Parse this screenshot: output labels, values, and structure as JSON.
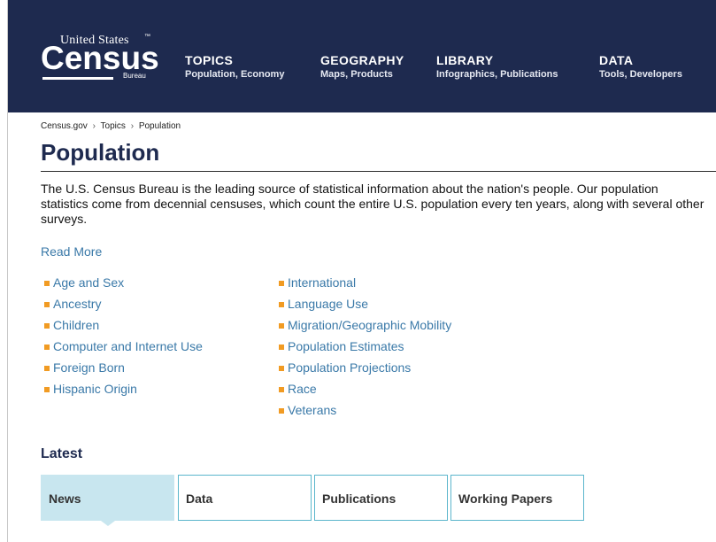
{
  "header": {
    "logo": {
      "top_text": "United States",
      "tm": "™",
      "word": "Census",
      "bottom_text": "Bureau"
    },
    "nav": [
      {
        "title": "TOPICS",
        "subtitle": "Population, Economy"
      },
      {
        "title": "GEOGRAPHY",
        "subtitle": "Maps, Products"
      },
      {
        "title": "LIBRARY",
        "subtitle": "Infographics, Publications"
      },
      {
        "title": "DATA",
        "subtitle": "Tools, Developers"
      }
    ]
  },
  "breadcrumb": {
    "items": [
      "Census.gov",
      "Topics",
      "Population"
    ],
    "separator": "›"
  },
  "page": {
    "title": "Population",
    "intro": "The U.S. Census Bureau is the leading source of statistical information about the nation's people. Our population statistics come from decennial censuses, which count the entire U.S. population every ten years, along with several other surveys.",
    "read_more": "Read More"
  },
  "topics": {
    "column1": [
      "Age and Sex",
      "Ancestry",
      "Children",
      "Computer and Internet Use",
      "Foreign Born",
      "Hispanic Origin"
    ],
    "column2": [
      "International",
      "Language Use",
      "Migration/Geographic Mobility",
      "Population Estimates",
      "Population Projections",
      "Race",
      "Veterans"
    ]
  },
  "latest": {
    "heading": "Latest",
    "tabs": [
      {
        "label": "News",
        "active": true
      },
      {
        "label": "Data",
        "active": false
      },
      {
        "label": "Publications",
        "active": false
      },
      {
        "label": "Working Papers",
        "active": false
      }
    ]
  },
  "colors": {
    "header_bg": "#1e2a4f",
    "link": "#3a79a8",
    "bullet": "#f19b23",
    "tab_active": "#c8e6ef",
    "tab_border": "#5bb6cc"
  }
}
